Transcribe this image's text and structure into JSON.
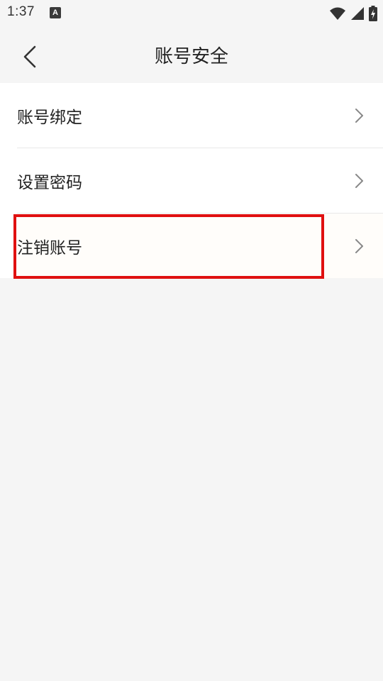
{
  "status_bar": {
    "time": "1:37",
    "notification_glyph": "A",
    "icons": [
      "wifi-icon",
      "signal-icon",
      "battery-charging-icon"
    ]
  },
  "header": {
    "title": "账号安全",
    "back_icon": "chevron-left-icon"
  },
  "menu": {
    "items": [
      {
        "label": "账号绑定",
        "icon": "chevron-right-icon"
      },
      {
        "label": "设置密码",
        "icon": "chevron-right-icon"
      },
      {
        "label": "注销账号",
        "icon": "chevron-right-icon",
        "highlighted": true
      }
    ]
  },
  "colors": {
    "background": "#f5f5f5",
    "card": "#ffffff",
    "highlight_border": "#e01010",
    "chevron": "#888888"
  }
}
